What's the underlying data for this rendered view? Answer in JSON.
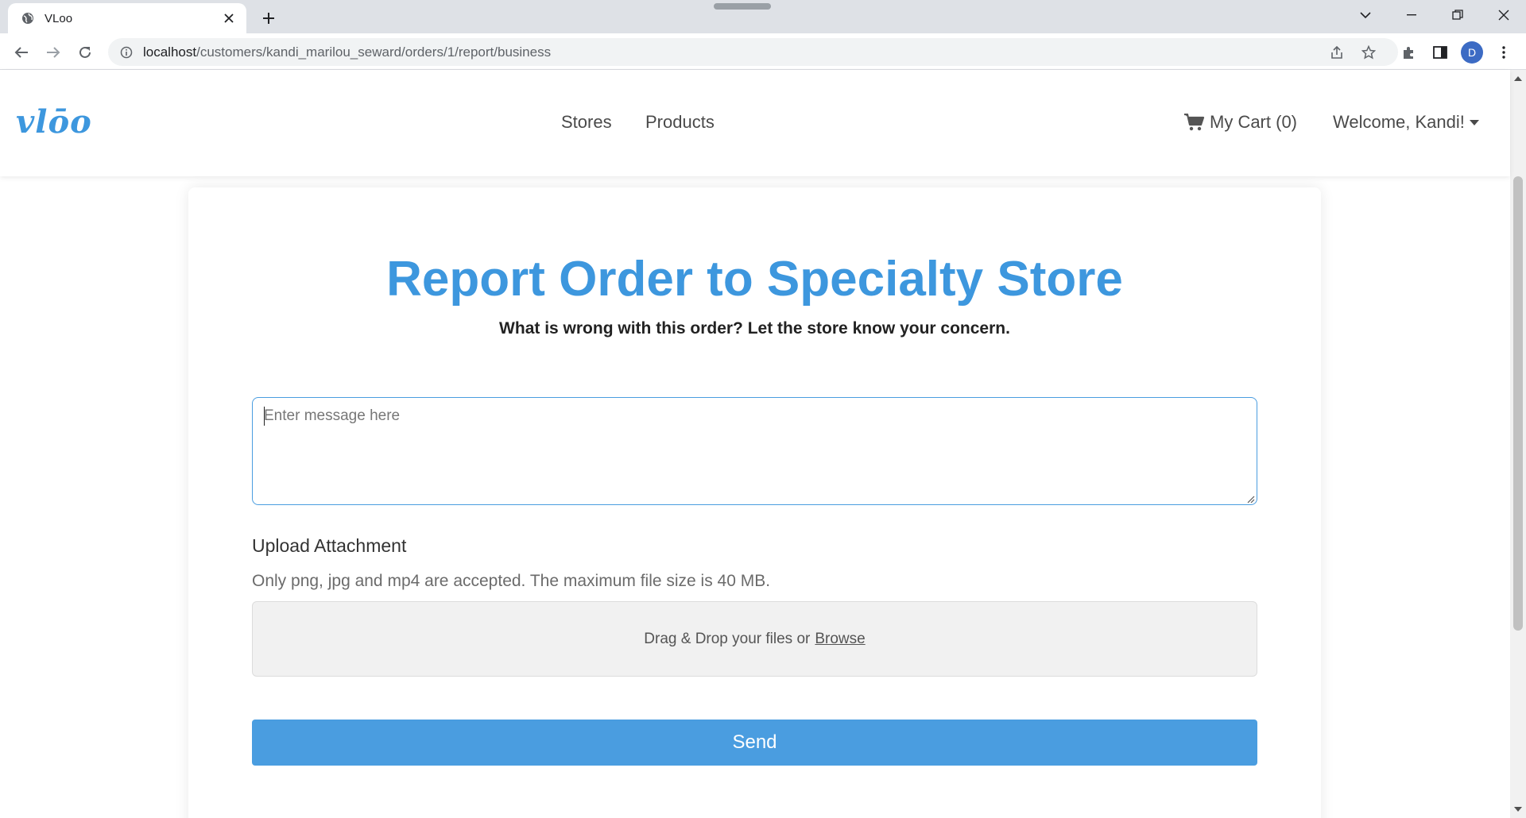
{
  "browser": {
    "tab_title": "VLoo",
    "url_host": "localhost",
    "url_path": "/customers/kandi_marilou_seward/orders/1/report/business",
    "profile_initial": "D"
  },
  "header": {
    "logo": "vlōo",
    "nav": [
      "Stores",
      "Products"
    ],
    "cart_label": "My Cart (0)",
    "welcome": "Welcome, Kandi!"
  },
  "main": {
    "title": "Report Order to Specialty Store",
    "subtitle": "What is wrong with this order? Let the store know your concern.",
    "message_placeholder": "Enter message here",
    "message_value": "",
    "upload_label": "Upload Attachment",
    "upload_hint": "Only png, jpg and mp4 are accepted. The maximum file size is 40 MB.",
    "dropzone_text": "Drag & Drop your files or",
    "browse_label": "Browse",
    "send_label": "Send"
  },
  "colors": {
    "brand": "#3d97de",
    "button": "#4a9de0"
  }
}
